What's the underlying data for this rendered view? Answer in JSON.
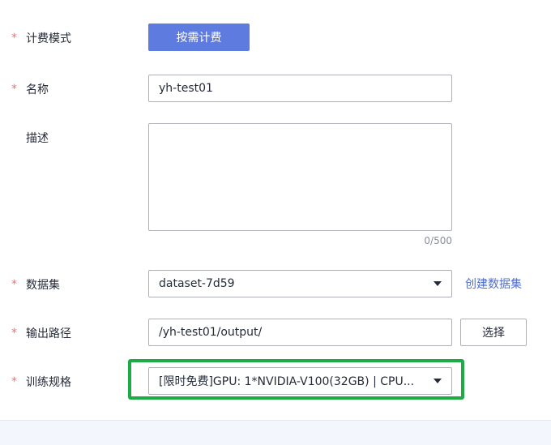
{
  "fields": {
    "billing": {
      "label": "计费模式",
      "button": "按需计费",
      "required": true
    },
    "name": {
      "label": "名称",
      "value": "yh-test01",
      "required": true
    },
    "description": {
      "label": "描述",
      "value": "",
      "counter": "0/500",
      "required": false
    },
    "dataset": {
      "label": "数据集",
      "value": "dataset-7d59",
      "link": "创建数据集",
      "required": true
    },
    "output": {
      "label": "输出路径",
      "value": "/yh-test01/output/",
      "button": "选择",
      "required": true
    },
    "spec": {
      "label": "训练规格",
      "value": "[限时免费]GPU: 1*NVIDIA-V100(32GB) | CPU...",
      "required": true
    }
  },
  "required_mark": "*",
  "colors": {
    "primary": "#5e7ce0",
    "link": "#526ecc",
    "required": "#f66f6a",
    "highlight": "#1dab45"
  },
  "icons": [
    "chevron-down-icon"
  ]
}
